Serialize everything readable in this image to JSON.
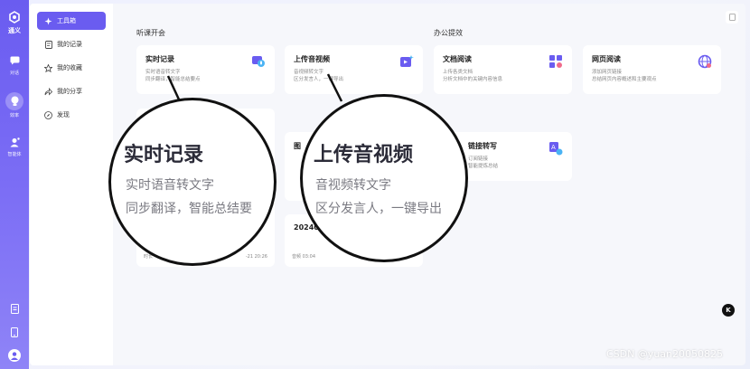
{
  "rail": {
    "logo_label": "通义",
    "items": [
      {
        "label": "对话",
        "icon": "chat-icon"
      },
      {
        "label": "效率",
        "icon": "bulb-icon",
        "active": true
      },
      {
        "label": "智能体",
        "icon": "agent-icon"
      }
    ],
    "bottom_icons": [
      "document-icon",
      "phone-icon",
      "user-avatar-icon"
    ]
  },
  "sidebar": {
    "items": [
      {
        "label": "工具箱",
        "icon": "toolbox-icon",
        "active": true
      },
      {
        "label": "我的记录",
        "icon": "record-icon"
      },
      {
        "label": "我的收藏",
        "icon": "star-icon"
      },
      {
        "label": "我的分享",
        "icon": "share-icon"
      },
      {
        "label": "发现",
        "icon": "compass-icon"
      }
    ]
  },
  "sections": {
    "meeting": "听课开会",
    "office": "办公提效"
  },
  "cards": {
    "realtime": {
      "title": "实时记录",
      "line1": "实时语音转文字",
      "line2": "同步翻译，智能总结要点",
      "icon": "mic-icon"
    },
    "upload": {
      "title": "上传音视频",
      "line1": "音视频转文字",
      "line2": "区分发言人，一键导出",
      "icon": "upload-video-icon"
    },
    "docread": {
      "title": "文档阅读",
      "line1": "上传各类文档",
      "line2": "分析文档中的关键内容信息",
      "icon": "doc-grid-icon"
    },
    "webread": {
      "title": "网页阅读",
      "line1": "添加网页链接",
      "line2": "总结网页内容概述和主要观点",
      "icon": "globe-icon"
    },
    "link": {
      "title": "链接转写",
      "line1": "订阅链接",
      "line2": "智能提炼总结",
      "icon": "translate-icon"
    },
    "pic_partial": {
      "title": "图"
    },
    "rec1": {
      "meta": "时长",
      "date": "-21 20:26"
    },
    "rec2": {
      "title": "20240",
      "meta": "音频 03:04"
    }
  },
  "magnifier_left": {
    "title": "实时记录",
    "line1": "实时语音转文字",
    "line2": "同步翻译，智能总结要"
  },
  "magnifier_right": {
    "title": "上传音视频",
    "line1": "音视频转文字",
    "line2": "区分发言人，一键导出"
  },
  "watermark": "CSDN @yuan20050825",
  "float_button": "K",
  "colors": {
    "accent": "#6a5cf0",
    "panel": "#f6f7fb"
  }
}
